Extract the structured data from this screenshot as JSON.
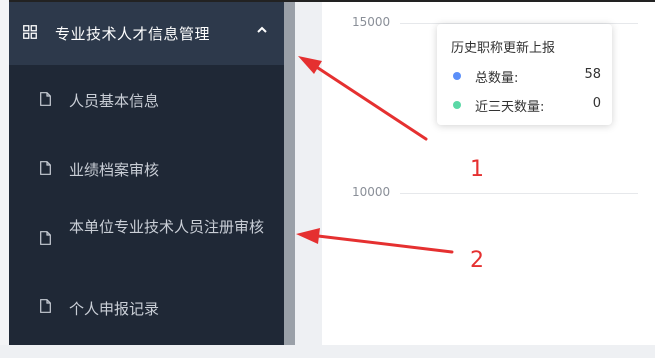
{
  "sidebar": {
    "header": {
      "title": "专业技术人才信息管理",
      "icon": "grid-icon",
      "toggle_icon": "chevron-up-icon"
    },
    "items": [
      {
        "label": "人员基本信息",
        "icon": "document-icon"
      },
      {
        "label": "业绩档案审核",
        "icon": "document-icon"
      },
      {
        "label": "本单位专业技术人员注册审核",
        "icon": "document-icon"
      },
      {
        "label": "个人申报记录",
        "icon": "document-icon"
      }
    ]
  },
  "chart": {
    "y_ticks": [
      "15000",
      "10000"
    ],
    "tooltip": {
      "title": "历史职称更新上报",
      "rows": [
        {
          "label": "总数量:",
          "value": "58",
          "color": "#5b8ff9"
        },
        {
          "label": "近三天数量:",
          "value": "0",
          "color": "#5ad8a6"
        }
      ]
    }
  },
  "annotations": [
    {
      "label": "1",
      "color": "#e53030"
    },
    {
      "label": "2",
      "color": "#e53030"
    }
  ],
  "colors": {
    "sidebar_bg": "#1f2836",
    "header_bg": "#2d394b",
    "annotation": "#e53030"
  }
}
